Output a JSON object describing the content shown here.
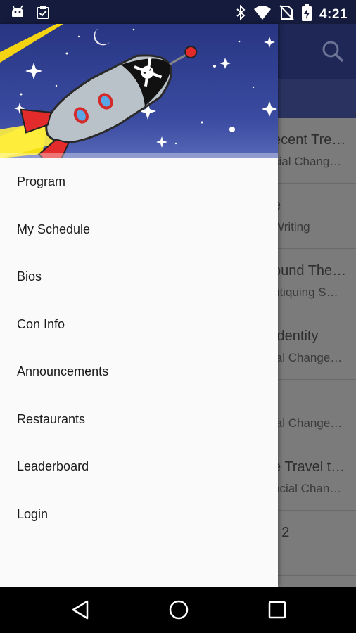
{
  "status_bar": {
    "time": "4:21",
    "left_icons": [
      "android-icon",
      "clipboard-check-icon"
    ],
    "right_icons": [
      "bluetooth-icon",
      "wifi-icon",
      "no-sim-icon",
      "battery-charging-icon"
    ]
  },
  "drawer": {
    "menu_items": [
      {
        "label": "Program"
      },
      {
        "label": "My Schedule"
      },
      {
        "label": "Bios"
      },
      {
        "label": "Con Info"
      },
      {
        "label": "Announcements"
      },
      {
        "label": "Restaurants"
      },
      {
        "label": "Leaderboard"
      },
      {
        "label": "Login"
      }
    ]
  },
  "background_list": {
    "items": [
      {
        "line1": "ecent Tre…",
        "line2": "cial Chang…"
      },
      {
        "line1": "e",
        "line2": "Writing"
      },
      {
        "line1": "ound The…",
        "line2": "ritiquing S…"
      },
      {
        "line1": "Identity",
        "line2": "ial Change…"
      },
      {
        "line1": "",
        "line2": "ial Change…"
      },
      {
        "line1": "e Travel t…",
        "line2": "ocial Chan…"
      },
      {
        "line1": "r 2",
        "line2": ""
      }
    ]
  },
  "colors": {
    "status_bar": "#141b3d",
    "header_sky": "#3a4ba0",
    "drawer_bg": "#fafafa"
  },
  "nav_bar": {
    "icons": [
      "back-icon",
      "home-icon",
      "recents-icon"
    ]
  }
}
